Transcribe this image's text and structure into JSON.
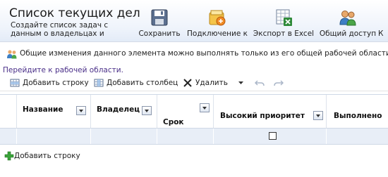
{
  "header": {
    "title": "Список текущих дел",
    "subtitle": "Создайте список задач с данным о владельцах и"
  },
  "ribbon": {
    "save_label": "Сохранить",
    "connect_label": "Подключение к",
    "excel_label": "Экспорт в Excel",
    "share_label": "Общий доступ",
    "more_label": "К"
  },
  "info": {
    "text": "Общие изменения данного элемента можно выполнять только из его общей рабочей области.",
    "link": "Перейдите к рабочей области."
  },
  "toolbar": {
    "add_row": "Добавить строку",
    "add_column": "Добавить столбец",
    "delete": "Удалить"
  },
  "table": {
    "columns": [
      "Название",
      "Владелец",
      "Срок",
      "Высокий приоритет",
      "Выполнено"
    ],
    "rows": [
      {
        "Название": "",
        "Владелец": "",
        "Срок": "",
        "Высокий приоритет": false,
        "Выполнено": ""
      }
    ]
  },
  "footer": {
    "add_row_label": "Добавить строку"
  },
  "colors": {
    "link": "#4a2f88",
    "row_highlight": "#e8eef7",
    "plus_green": "#3aa33a"
  }
}
